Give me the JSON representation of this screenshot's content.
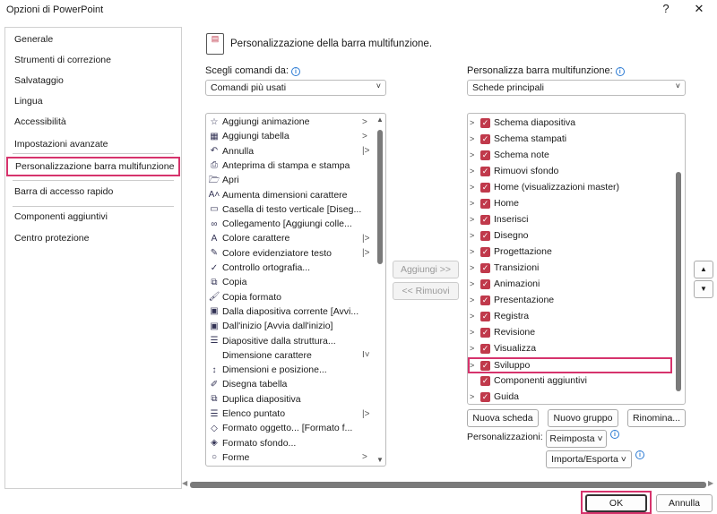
{
  "window": {
    "title": "Opzioni di PowerPoint",
    "help": "?",
    "close": "✕"
  },
  "sidebar": {
    "items": [
      "Generale",
      "Strumenti di correzione",
      "Salvataggio",
      "Lingua",
      "Accessibilità",
      "Impostazioni avanzate",
      "Personalizzazione barra multifunzione",
      "Barra di accesso rapido",
      "Componenti aggiuntivi",
      "Centro protezione"
    ],
    "selected": 6
  },
  "main": {
    "title": "Personalizzazione della barra multifunzione.",
    "choose_label": "Scegli comandi da:",
    "choose_value": "Comandi più usati",
    "commands": [
      {
        "label": "Aggiungi animazione",
        "icon": "☆",
        "arrow": ">"
      },
      {
        "label": "Aggiungi tabella",
        "icon": "▦",
        "arrow": ">"
      },
      {
        "label": "Annulla",
        "icon": "↶",
        "arrow": "|>"
      },
      {
        "label": "Anteprima di stampa e stampa",
        "icon": "⎙"
      },
      {
        "label": "Apri",
        "icon": "🗁"
      },
      {
        "label": "Aumenta dimensioni carattere",
        "icon": "A˄"
      },
      {
        "label": "Casella di testo verticale [Diseg...",
        "icon": "▭"
      },
      {
        "label": "Collegamento [Aggiungi colle...",
        "icon": "∞"
      },
      {
        "label": "Colore carattere",
        "icon": "A",
        "arrow": "|>"
      },
      {
        "label": "Colore evidenziatore testo",
        "icon": "✎",
        "arrow": "|>"
      },
      {
        "label": "Controllo ortografia...",
        "icon": "✓"
      },
      {
        "label": "Copia",
        "icon": "⧉"
      },
      {
        "label": "Copia formato",
        "icon": "🖌"
      },
      {
        "label": "Dalla diapositiva corrente [Avvi...",
        "icon": "▣"
      },
      {
        "label": "Dall'inizio [Avvia dall'inizio]",
        "icon": "▣"
      },
      {
        "label": "Diapositive dalla struttura...",
        "icon": "☰"
      },
      {
        "label": "Dimensione carattere",
        "icon": "",
        "arrow": "I˅"
      },
      {
        "label": "Dimensioni e posizione...",
        "icon": "↕"
      },
      {
        "label": "Disegna tabella",
        "icon": "✐"
      },
      {
        "label": "Duplica diapositiva",
        "icon": "⧉"
      },
      {
        "label": "Elenco puntato",
        "icon": "☰",
        "arrow": "|>"
      },
      {
        "label": "Formato oggetto... [Formato f...",
        "icon": "◇"
      },
      {
        "label": "Formato sfondo...",
        "icon": "◈"
      },
      {
        "label": "Forme",
        "icon": "○",
        "arrow": ">"
      }
    ],
    "add_button": "Aggiungi >>",
    "remove_button": "<< Rimuovi",
    "customize_label": "Personalizza barra multifunzione:",
    "customize_value": "Schede principali",
    "tabs": [
      {
        "label": "Schema diapositiva",
        "checked": true,
        "expand": true
      },
      {
        "label": "Schema stampati",
        "checked": true,
        "expand": true
      },
      {
        "label": "Schema note",
        "checked": true,
        "expand": true
      },
      {
        "label": "Rimuovi sfondo",
        "checked": true,
        "expand": true
      },
      {
        "label": "Home (visualizzazioni master)",
        "checked": true,
        "expand": true
      },
      {
        "label": "Home",
        "checked": true,
        "expand": true
      },
      {
        "label": "Inserisci",
        "checked": true,
        "expand": true
      },
      {
        "label": "Disegno",
        "checked": true,
        "expand": true
      },
      {
        "label": "Progettazione",
        "checked": true,
        "expand": true
      },
      {
        "label": "Transizioni",
        "checked": true,
        "expand": true
      },
      {
        "label": "Animazioni",
        "checked": true,
        "expand": true
      },
      {
        "label": "Presentazione",
        "checked": true,
        "expand": true
      },
      {
        "label": "Registra",
        "checked": true,
        "expand": true
      },
      {
        "label": "Revisione",
        "checked": true,
        "expand": true
      },
      {
        "label": "Visualizza",
        "checked": true,
        "expand": true
      },
      {
        "label": "Sviluppo",
        "checked": true,
        "expand": true
      },
      {
        "label": "Componenti aggiuntivi",
        "checked": true,
        "expand": false
      },
      {
        "label": "Guida",
        "checked": true,
        "expand": true
      }
    ],
    "highlight_tab": 15,
    "new_tab": "Nuova scheda",
    "new_group": "Nuovo gruppo",
    "rename": "Rinomina...",
    "customizations_label": "Personalizzazioni:",
    "reset": "Reimposta",
    "import_export": "Importa/Esporta"
  },
  "footer": {
    "ok": "OK",
    "cancel": "Annulla"
  },
  "colors": {
    "accent": "#d6336c",
    "check": "#c0394b"
  }
}
